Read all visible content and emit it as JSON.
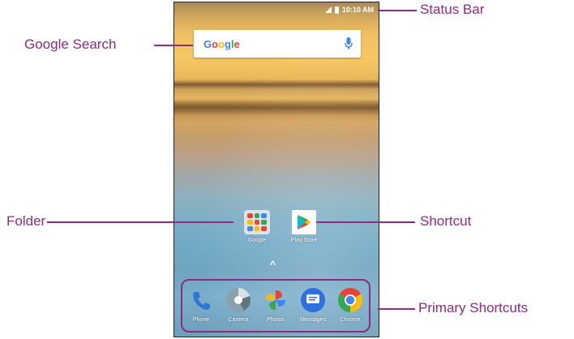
{
  "status_bar": {
    "time": "10:10 AM",
    "icons": [
      "signal-icon",
      "battery-icon"
    ]
  },
  "search": {
    "logo_text": "Google",
    "icon": "microphone-icon"
  },
  "home_apps": [
    {
      "label": "Google",
      "icon": "folder-icon"
    },
    {
      "label": "Play Store",
      "icon": "play-store-icon"
    }
  ],
  "dock": [
    {
      "label": "Phone",
      "icon": "phone-icon"
    },
    {
      "label": "Camera",
      "icon": "camera-icon"
    },
    {
      "label": "Photos",
      "icon": "photos-icon"
    },
    {
      "label": "Messages",
      "icon": "messages-icon"
    },
    {
      "label": "Chrome",
      "icon": "chrome-icon"
    }
  ],
  "callouts": {
    "status_bar": "Status Bar",
    "google_search": "Google Search",
    "folder": "Folder",
    "shortcut": "Shortcut",
    "primary_shortcuts": "Primary Shortcuts"
  },
  "colors": {
    "accent": "#8b2c7f",
    "screen_border": "#222222"
  }
}
